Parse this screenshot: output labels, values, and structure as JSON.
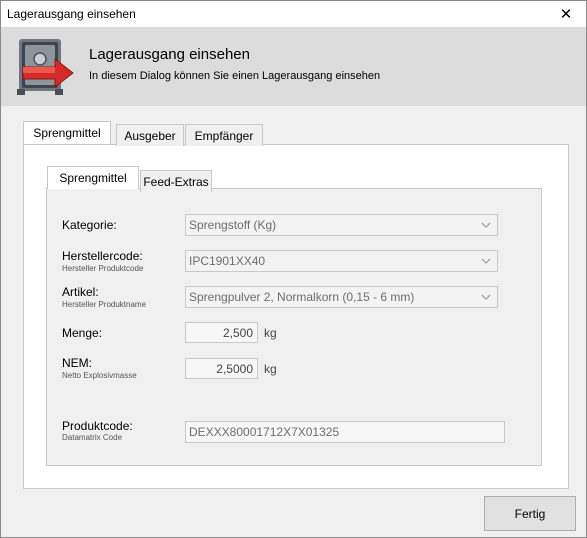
{
  "window": {
    "title": "Lagerausgang einsehen",
    "close_glyph": "✕"
  },
  "header": {
    "title": "Lagerausgang einsehen",
    "subtitle": "In diesem Dialog können Sie einen Lagerausgang einsehen",
    "icon": "safe-export-icon"
  },
  "outer_tabs": [
    {
      "label": "Sprengmittel",
      "active": true
    },
    {
      "label": "Ausgeber",
      "active": false
    },
    {
      "label": "Empfänger",
      "active": false
    }
  ],
  "inner_tabs": [
    {
      "label": "Sprengmittel",
      "active": true
    },
    {
      "label": "Feed-Extras",
      "active": false
    }
  ],
  "form": {
    "kategorie": {
      "label": "Kategorie:",
      "value": "Sprengstoff (Kg)"
    },
    "herstellercode": {
      "label": "Herstellercode:",
      "sublabel": "Hersteller Produktcode",
      "value": "IPC1901XX40"
    },
    "artikel": {
      "label": "Artikel:",
      "sublabel": "Hersteller Produktname",
      "value": "Sprengpulver 2, Normalkorn (0,15 - 6 mm)"
    },
    "menge": {
      "label": "Menge:",
      "value": "2,500",
      "unit": "kg"
    },
    "nem": {
      "label": "NEM:",
      "sublabel": "Netto Explosivmasse",
      "value": "2,5000",
      "unit": "kg"
    },
    "produktcode": {
      "label": "Produktcode:",
      "sublabel": "Datamatrix Code",
      "value": "DEXXX80001712X7X01325"
    }
  },
  "footer": {
    "done_label": "Fertig"
  },
  "colors": {
    "header_bg": "#dcdcdc",
    "window_bg": "#f0f0f0",
    "accent_red": "#d42a2a"
  }
}
